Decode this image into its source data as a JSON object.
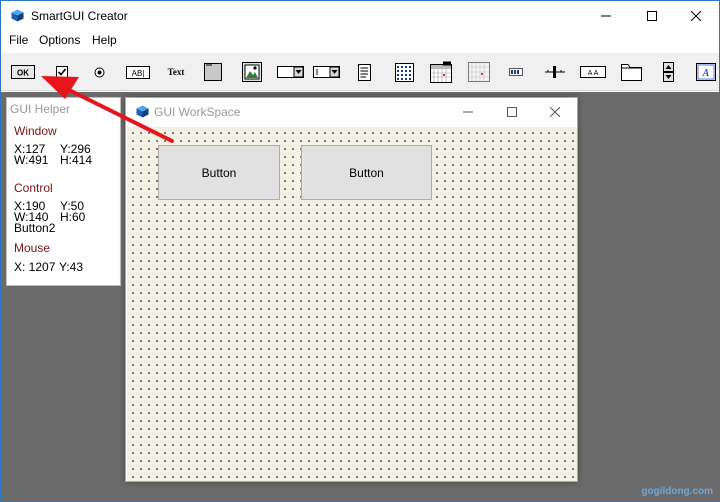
{
  "app": {
    "title": "SmartGUI Creator",
    "accent": "#2b78c4"
  },
  "menu": [
    "File",
    "Options",
    "Help"
  ],
  "toolbar": {
    "ok_label": "OK",
    "edit_label": "AB|",
    "text_label": "Text",
    "slider_label": "A  A",
    "tools": [
      "button-tool",
      "checkbox-tool",
      "radio-tool",
      "edit-tool",
      "text-tool",
      "groupbox-tool",
      "picture-tool",
      "dropdown-tool",
      "combobox-tool",
      "listbox-tool",
      "listview-tool",
      "datetime-tool",
      "monthcal-tool",
      "progress-tool",
      "slider-tool",
      "hotkey-tool",
      "tab-tool",
      "updown-tool",
      "font-tool"
    ]
  },
  "helper": {
    "title": "GUI Helper",
    "window_label": "Window",
    "window_x": "X:127",
    "window_y": "Y:296",
    "window_w": "W:491",
    "window_h": "H:414",
    "control_label": "Control",
    "control_x": "X:190",
    "control_y": "Y:50",
    "control_w": "W:140",
    "control_h": "H:60",
    "control_name": "Button2",
    "mouse_label": "Mouse",
    "mouse_x": "X: 1207",
    "mouse_y": "Y:43"
  },
  "workspace": {
    "title": "GUI WorkSpace",
    "buttons": [
      "Button",
      "Button"
    ]
  },
  "watermark": "gogildong.com",
  "colors": {
    "desk": "#6b6b6b",
    "grid_bg": "#f4f2e4",
    "section_label": "#7a1414",
    "arrow": "#e8141b"
  }
}
